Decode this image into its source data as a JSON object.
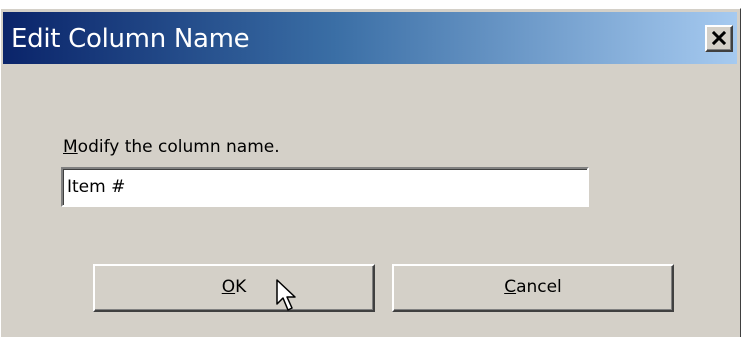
{
  "window": {
    "title": "Edit Column Name"
  },
  "title_bar": {
    "close_icon": "close-icon",
    "close_symbol": "×"
  },
  "form": {
    "prompt_label": "Modify the column name.",
    "column_name_value": "Item #"
  },
  "buttons": {
    "ok_label": "OK",
    "cancel_label": "Cancel"
  },
  "colors": {
    "dialog_face": "#d4d0c8",
    "titlebar_start": "#0a246a",
    "titlebar_end": "#a6caf0"
  }
}
